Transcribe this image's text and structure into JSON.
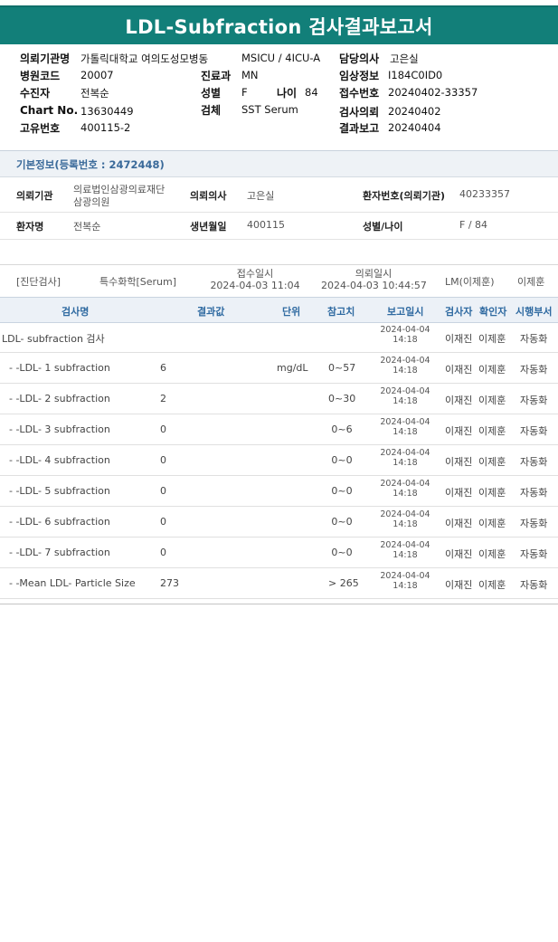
{
  "report": {
    "title": "LDL-Subfraction 검사결과보고서"
  },
  "info": {
    "institution_label": "의뢰기관명",
    "institution_value": "가톨릭대학교 여의도성모병동",
    "ward_value": "MSICU / 4ICU-A",
    "doctor_label": "담당의사",
    "doctor_value": "고은실",
    "hospital_code_label": "병원코드",
    "hospital_code_value": "20007",
    "department_label": "진료과",
    "department_value": "MN",
    "clinical_label": "임상정보",
    "clinical_value": "I184C0ID0",
    "receiver_label": "수진자",
    "receiver_value": "전복순",
    "sex_label": "성별",
    "sex_value": "F",
    "age_label": "나이",
    "age_value": "84",
    "receipt_no_label": "접수번호",
    "receipt_no_value": "20240402-33357",
    "chart_label": "Chart No.",
    "chart_value": "13630449",
    "specimen_label": "검체",
    "specimen_value": "SST Serum",
    "request_label": "검사의뢰",
    "request_value": "20240402",
    "unique_label": "고유번호",
    "unique_value": "400115-2",
    "report_label": "결과보고",
    "report_value": "20240404"
  },
  "basic": {
    "section_title": "기본정보(등록번호 : 2472448)",
    "req_inst_label": "의뢰기관",
    "req_inst_value_1": "의료법인삼광의료재단",
    "req_inst_value_2": "삼광의원",
    "req_doc_label": "의뢰의사",
    "req_doc_value": "고은실",
    "patient_no_label": "환자번호(의뢰기관)",
    "patient_no_value": "40233357",
    "name_label": "환자명",
    "name_value": "전복순",
    "dob_label": "생년월일",
    "dob_value": "400115",
    "sexage_label": "성별/나이",
    "sexage_value": "F / 84"
  },
  "order": {
    "diag": "[진단검사]",
    "category": "특수화학[Serum]",
    "receipt_label": "접수일시",
    "receipt_value": "2024-04-03 11:04",
    "request_label": "의뢰일시",
    "request_value": "2024-04-03 10:44:57",
    "lm": "LM(이제훈)",
    "person": "이제훈"
  },
  "table": {
    "headers": [
      "검사명",
      "결과값",
      "단위",
      "참고치",
      "보고일시",
      "검사자",
      "확인자",
      "시행부서"
    ],
    "rows": [
      {
        "name": "LDL- subfraction 검사",
        "value": "",
        "unit": "",
        "ref": "",
        "date": "2024-04-04",
        "time": "14:18",
        "tester": "이재진",
        "checker": "이제훈",
        "dept": "자동화"
      },
      {
        "name": "- -LDL- 1 subfraction",
        "value": "6",
        "unit": "mg/dL",
        "ref": "0~57",
        "date": "2024-04-04",
        "time": "14:18",
        "tester": "이재진",
        "checker": "이제훈",
        "dept": "자동화"
      },
      {
        "name": "- -LDL- 2 subfraction",
        "value": "2",
        "unit": "",
        "ref": "0~30",
        "date": "2024-04-04",
        "time": "14:18",
        "tester": "이재진",
        "checker": "이제훈",
        "dept": "자동화"
      },
      {
        "name": "- -LDL- 3 subfraction",
        "value": "0",
        "unit": "",
        "ref": "0~6",
        "date": "2024-04-04",
        "time": "14:18",
        "tester": "이재진",
        "checker": "이제훈",
        "dept": "자동화"
      },
      {
        "name": "- -LDL- 4 subfraction",
        "value": "0",
        "unit": "",
        "ref": "0~0",
        "date": "2024-04-04",
        "time": "14:18",
        "tester": "이재진",
        "checker": "이제훈",
        "dept": "자동화"
      },
      {
        "name": "- -LDL- 5 subfraction",
        "value": "0",
        "unit": "",
        "ref": "0~0",
        "date": "2024-04-04",
        "time": "14:18",
        "tester": "이재진",
        "checker": "이제훈",
        "dept": "자동화"
      },
      {
        "name": "- -LDL- 6 subfraction",
        "value": "0",
        "unit": "",
        "ref": "0~0",
        "date": "2024-04-04",
        "time": "14:18",
        "tester": "이재진",
        "checker": "이제훈",
        "dept": "자동화"
      },
      {
        "name": "- -LDL- 7 subfraction",
        "value": "0",
        "unit": "",
        "ref": "0~0",
        "date": "2024-04-04",
        "time": "14:18",
        "tester": "이재진",
        "checker": "이제훈",
        "dept": "자동화"
      },
      {
        "name": "- -Mean LDL- Particle Size",
        "value": "273",
        "unit": "",
        "ref": "> 265",
        "date": "2024-04-04",
        "time": "14:18",
        "tester": "이재진",
        "checker": "이제훈",
        "dept": "자동화"
      }
    ]
  }
}
